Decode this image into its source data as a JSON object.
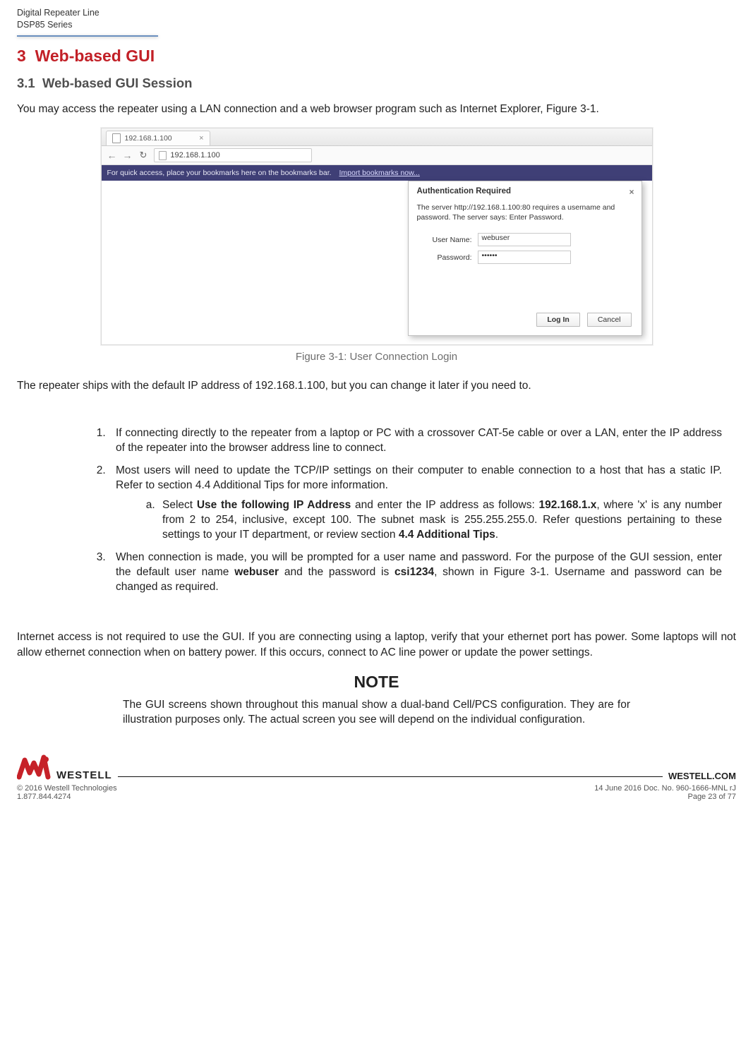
{
  "header": {
    "line1": "Digital Repeater Line",
    "line2": "DSP85 Series"
  },
  "section": {
    "number": "3",
    "title": "Web-based GUI",
    "sub_number": "3.1",
    "sub_title": "Web-based GUI Session"
  },
  "intro_para": "You may access the repeater using a LAN connection and a web browser program such as Internet Explorer, Figure 3-1.",
  "figure": {
    "caption": "Figure 3-1: User Connection Login",
    "tab_ip": "192.168.1.100",
    "url_ip": "192.168.1.100",
    "bookmarks_text": "For quick access, place your bookmarks here on the bookmarks bar.",
    "bookmarks_link": "Import bookmarks now...",
    "dialog_title": "Authentication Required",
    "dialog_msg": "The server http://192.168.1.100:80 requires a username and password. The server says: Enter Password.",
    "username_label": "User Name:",
    "username_value": "webuser",
    "password_label": "Password:",
    "password_value": "••••••",
    "login_btn": "Log In",
    "cancel_btn": "Cancel"
  },
  "default_ip_para": "The repeater ships with the default IP address of 192.168.1.100, but you can change it later if you need to.",
  "steps": {
    "s1": "If connecting directly to the repeater from a laptop or PC with a crossover CAT-5e cable or over a LAN, enter the IP address of the repeater into the browser address line to connect.",
    "s2": "Most users will need to update the TCP/IP settings on their computer to enable connection to a host that has a static IP.  Refer to section 4.4 Additional Tips for more information.",
    "s2a_pre": "Select ",
    "s2a_bold1": "Use the following IP Address",
    "s2a_mid1": " and enter the IP address as follows: ",
    "s2a_bold2": "192.168.1.x",
    "s2a_mid2": ", where 'x' is any number from 2 to 254, inclusive, except 100.  The subnet mask is 255.255.255.0.  Refer questions pertaining to these settings to your IT department, or review section ",
    "s2a_bold3": "4.4 Additional Tips",
    "s2a_end": ".",
    "s3_pre": "When connection is made, you will be prompted for a user name and password.  For the purpose of the GUI session, enter the default user name ",
    "s3_bold1": "webuser",
    "s3_mid": " and the password is ",
    "s3_bold2": "csi1234",
    "s3_end": ", shown in Figure 3-1.  Username and password can be changed as required."
  },
  "internet_para": "Internet access is not required to use the GUI.  If you are connecting using a laptop, verify that your ethernet port has power.  Some laptops will not allow ethernet connection when on battery power.  If this occurs, connect to AC line power or update the power settings.",
  "note": {
    "title": "NOTE",
    "body": "The GUI screens shown throughout this manual show a dual-band Cell/PCS configuration. They are for illustration purposes only. The actual screen you see will depend on the individual configuration."
  },
  "footer": {
    "logo_text": "WESTELL",
    "site": "WESTELL.COM",
    "copyright": "© 2016 Westell Technologies",
    "docnum": "14 June 2016 Doc. No. 960-1666-MNL rJ",
    "phone": "1.877.844.4274",
    "page": "Page 23 of 77"
  }
}
